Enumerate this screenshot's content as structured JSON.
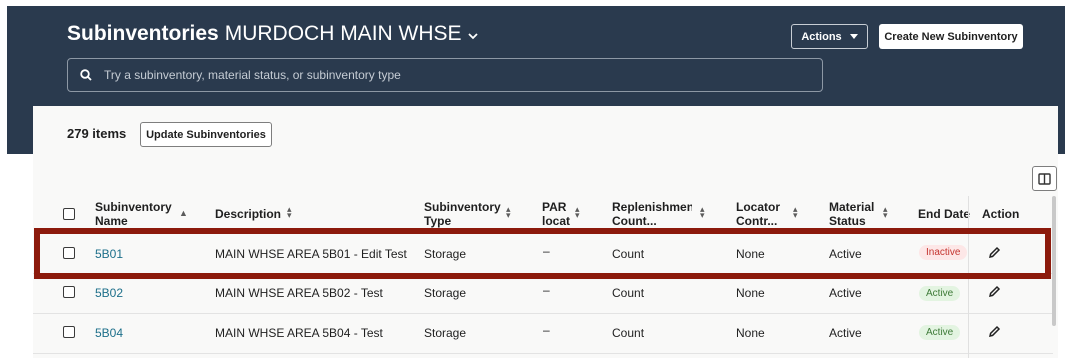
{
  "header": {
    "title": "Subinventories",
    "organization": "MURDOCH MAIN WHSE",
    "actions_label": "Actions",
    "create_label": "Create New Subinventory"
  },
  "search": {
    "placeholder": "Try a subinventory, material status, or subinventory type"
  },
  "toolbar": {
    "count": "279 items",
    "update_label": "Update Subinventories"
  },
  "table": {
    "columns": [
      "Subinventory Name",
      "Description",
      "Subinventory Type",
      "PAR locat",
      "Replenishmen Count...",
      "Locator Contr...",
      "Material Status",
      "End Date",
      "Action"
    ],
    "rows": [
      {
        "name": "5B01",
        "description": "MAIN WHSE AREA 5B01 - Edit Test",
        "type": "Storage",
        "par": "–",
        "replenishment": "Count",
        "locator": "None",
        "status": "Active",
        "end_date": "Inactive"
      },
      {
        "name": "5B02",
        "description": "MAIN WHSE AREA 5B02 - Test",
        "type": "Storage",
        "par": "–",
        "replenishment": "Count",
        "locator": "None",
        "status": "Active",
        "end_date": "Active"
      },
      {
        "name": "5B04",
        "description": "MAIN WHSE AREA 5B04 - Test",
        "type": "Storage",
        "par": "–",
        "replenishment": "Count",
        "locator": "None",
        "status": "Active",
        "end_date": "Active"
      }
    ]
  },
  "colors": {
    "header_bg": "#2a3a4e",
    "link": "#1d6f8a",
    "highlight": "#8c1a0c"
  }
}
